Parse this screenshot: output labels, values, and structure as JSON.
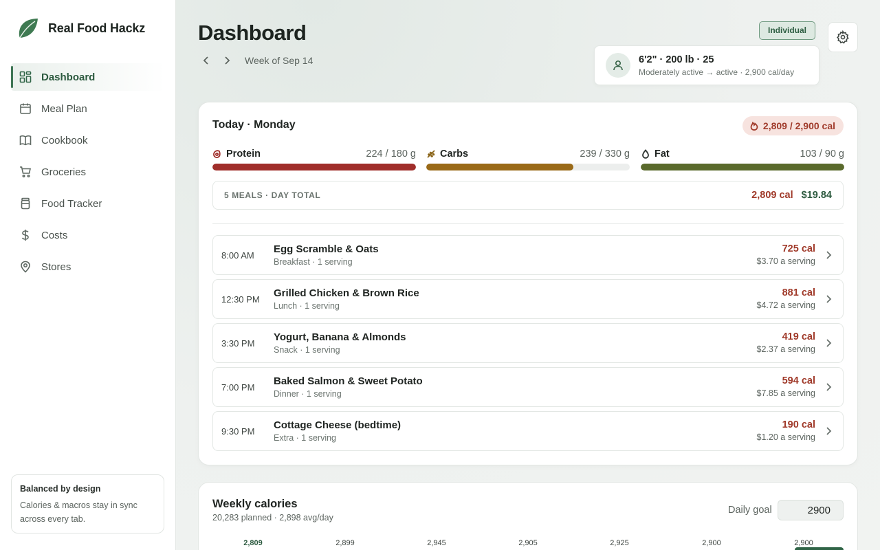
{
  "app": {
    "name": "Real Food Hackz"
  },
  "sidebar": {
    "items": [
      {
        "label": "Dashboard",
        "icon": "dashboard-grid-icon",
        "active": true
      },
      {
        "label": "Meal Plan",
        "icon": "calendar-icon",
        "active": false
      },
      {
        "label": "Cookbook",
        "icon": "book-icon",
        "active": false
      },
      {
        "label": "Groceries",
        "icon": "cart-icon",
        "active": false
      },
      {
        "label": "Food Tracker",
        "icon": "jar-icon",
        "active": false
      },
      {
        "label": "Costs",
        "icon": "dollar-icon",
        "active": false
      },
      {
        "label": "Stores",
        "icon": "map-pin-icon",
        "active": false
      }
    ],
    "tip": {
      "title": "Balanced by design",
      "body": "Calories & macros stay in sync across every tab."
    }
  },
  "header": {
    "title": "Dashboard",
    "week_label": "Week of Sep 14",
    "mode_badge": "Individual"
  },
  "profile": {
    "stats": "6'2\" · 200 lb · 25",
    "activity": "Moderately active → active · 2,900 cal/day"
  },
  "today": {
    "title": "Today · Monday",
    "calories_pill": "2,809 / 2,900 cal",
    "macros": [
      {
        "name": "Protein",
        "value": "224 / 180 g",
        "fraction": 1.0,
        "color": "#a02e2a",
        "icon": "protein-icon"
      },
      {
        "name": "Carbs",
        "value": "239 / 330 g",
        "fraction": 0.724,
        "color": "#9a6a18",
        "icon": "wheat-icon"
      },
      {
        "name": "Fat",
        "value": "103 / 90 g",
        "fraction": 1.0,
        "color": "#5a6a2c",
        "icon": "droplet-icon"
      }
    ],
    "day_total": {
      "label": "5 MEALS · DAY TOTAL",
      "calories": "2,809 cal",
      "cost": "$19.84"
    },
    "meals": [
      {
        "time": "8:00 AM",
        "name": "Egg Scramble & Oats",
        "sub": "Breakfast · 1 serving",
        "calories": "725 cal",
        "cost": "$3.70 a serving"
      },
      {
        "time": "12:30 PM",
        "name": "Grilled Chicken & Brown Rice",
        "sub": "Lunch · 1 serving",
        "calories": "881 cal",
        "cost": "$4.72 a serving"
      },
      {
        "time": "3:30 PM",
        "name": "Yogurt, Banana & Almonds",
        "sub": "Snack · 1 serving",
        "calories": "419 cal",
        "cost": "$2.37 a serving"
      },
      {
        "time": "7:00 PM",
        "name": "Baked Salmon & Sweet Potato",
        "sub": "Dinner · 1 serving",
        "calories": "594 cal",
        "cost": "$7.85 a serving"
      },
      {
        "time": "9:30 PM",
        "name": "Cottage Cheese (bedtime)",
        "sub": "Extra · 1 serving",
        "calories": "190 cal",
        "cost": "$1.20 a serving"
      }
    ]
  },
  "weekly": {
    "title": "Weekly calories",
    "subtitle": "20,283 planned · 2,898 avg/day",
    "goal_label": "Daily goal",
    "goal_value": "2900",
    "day_values": [
      "2,809",
      "2,899",
      "2,945",
      "2,905",
      "2,925",
      "2,900",
      "2,900"
    ]
  },
  "colors": {
    "accent": "#2c5a3f",
    "calorie_red": "#a03a2a"
  }
}
